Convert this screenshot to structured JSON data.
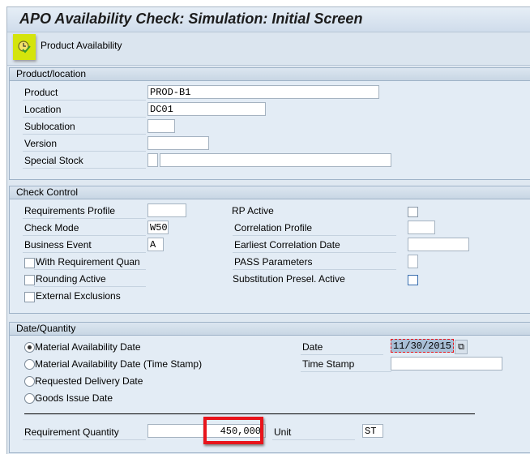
{
  "title": "APO Availability Check: Simulation: Initial Screen",
  "toolbar": {
    "product_availability": "Product Availability",
    "icon": "clock-check-icon"
  },
  "product_location": {
    "header": "Product/location",
    "product_label": "Product",
    "product": "PROD-B1",
    "location_label": "Location",
    "location": "DC01",
    "sublocation_label": "Sublocation",
    "sublocation": "",
    "version_label": "Version",
    "version": "",
    "special_stock_label": "Special Stock",
    "special_stock": ""
  },
  "check_control": {
    "header": "Check Control",
    "req_profile_label": "Requirements Profile",
    "req_profile": "",
    "check_mode_label": "Check Mode",
    "check_mode": "W50",
    "business_event_label": "Business Event",
    "business_event": "A",
    "with_req_quan": "With Requirement Quan",
    "rounding_active": "Rounding Active",
    "external_exclusions": "External Exclusions",
    "rp_active_label": "RP Active",
    "correlation_profile_label": "Correlation Profile",
    "earliest_corr_date_label": "Earliest Correlation Date",
    "pass_params_label": "PASS Parameters",
    "substitution_label": "Substitution Presel. Active"
  },
  "date_quantity": {
    "header": "Date/Quantity",
    "options": [
      "Material Availability Date",
      "Material Availability Date (Time Stamp)",
      "Requested Delivery Date",
      "Goods Issue Date"
    ],
    "selected": 0,
    "date_label": "Date",
    "date": "11/30/2015",
    "time_stamp_label": "Time Stamp",
    "time_stamp": "",
    "req_qty_label": "Requirement Quantity",
    "req_qty": "450,000",
    "unit_label": "Unit",
    "unit": "ST"
  },
  "colors": {
    "highlight": "#d4e40c",
    "annotation": "#e8141b"
  }
}
